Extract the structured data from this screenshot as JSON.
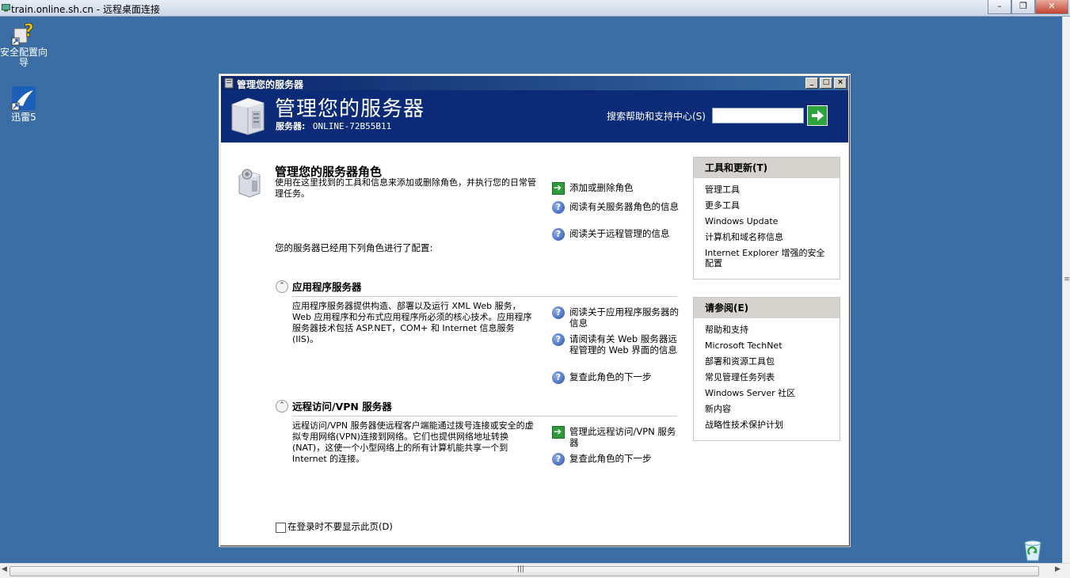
{
  "rdp": {
    "title": "train.online.sh.cn - 远程桌面连接",
    "buttons": {
      "minimize": "–",
      "restore": "❐",
      "close": "✕"
    }
  },
  "desktop": {
    "icons": [
      {
        "label": "安全配置向导",
        "icon": "security-wizard-icon"
      },
      {
        "label": "迅雷5",
        "icon": "thunder-icon"
      }
    ]
  },
  "window": {
    "title": "管理您的服务器",
    "header_title": "管理您的服务器",
    "server_label": "服务器:",
    "server_name": "ONLINE-72B55B11",
    "search_label": "搜索帮助和支持中心(S)",
    "search_value": ""
  },
  "main": {
    "section_title": "管理您的服务器角色",
    "intro": "使用在这里找到的工具和信息来添加或删除角色，并执行您的日常管理任务。",
    "configured_text": "您的服务器已经用下列角色进行了配置:",
    "top_links": [
      {
        "label": "添加或删除角色",
        "icon": "arrow-icon"
      },
      {
        "label": "阅读有关服务器角色的信息",
        "icon": "help-icon"
      },
      {
        "label": "阅读关于远程管理的信息",
        "icon": "help-icon"
      }
    ],
    "roles": [
      {
        "title": "应用程序服务器",
        "description": "应用程序服务器提供构造、部署以及运行 XML Web 服务，Web 应用程序和分布式应用程序所必须的核心技术。应用程序服务器技术包括 ASP.NET，COM+ 和 Internet 信息服务(IIS)。",
        "links": [
          {
            "label": "阅读关于应用程序服务器的信息",
            "icon": "help-icon"
          },
          {
            "label": "请阅读有关 Web 服务器远程管理的 Web 界面的信息",
            "icon": "help-icon"
          },
          {
            "label": "复查此角色的下一步",
            "icon": "help-icon"
          }
        ]
      },
      {
        "title": "远程访问/VPN 服务器",
        "description": "远程访问/VPN 服务器使远程客户端能通过拨号连接或安全的虚拟专用网络(VPN)连接到网络。它们也提供网络地址转换(NAT)，这使一个小型网络上的所有计算机能共享一个到 Internet 的连接。",
        "links": [
          {
            "label": "管理此远程访问/VPN 服务器",
            "icon": "arrow-icon"
          },
          {
            "label": "复查此角色的下一步",
            "icon": "help-icon"
          }
        ]
      }
    ],
    "dont_show_label": "在登录时不要显示此页(D)"
  },
  "sidebar": {
    "tools": {
      "title": "工具和更新(T)",
      "items": [
        "管理工具",
        "更多工具",
        "Windows Update",
        "计算机和域名称信息",
        "Internet Explorer 增强的安全配置"
      ]
    },
    "see_also": {
      "title": "请参阅(E)",
      "items": [
        "帮助和支持",
        "Microsoft TechNet",
        "部署和资源工具包",
        "常见管理任务列表",
        "Windows Server 社区",
        "新内容",
        "战略性技术保护计划"
      ]
    }
  },
  "colors": {
    "desktop": "#3a6ea5",
    "header": "#0b2b78",
    "panel_header": "#d6d3ce"
  }
}
